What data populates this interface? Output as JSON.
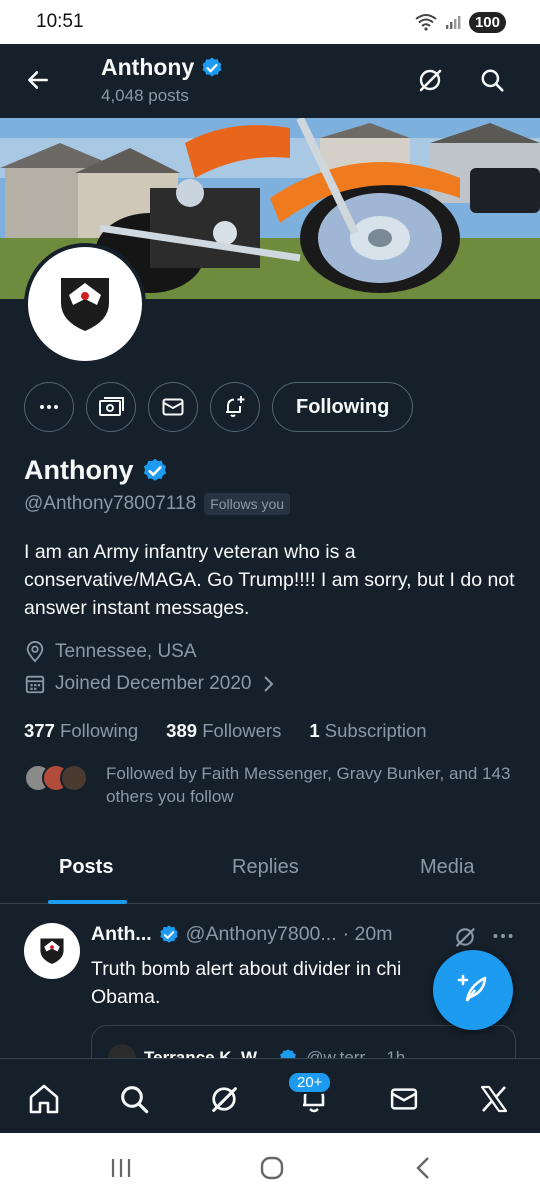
{
  "status_bar": {
    "time": "10:51",
    "battery": "100"
  },
  "header": {
    "name": "Anthony",
    "posts": "4,048 posts"
  },
  "profile": {
    "name": "Anthony",
    "handle": "@Anthony78007118",
    "follows_you": "Follows you",
    "bio": "I am an Army infantry veteran who is a conservative/MAGA. Go Trump!!!! I am sorry, but I do not answer instant messages.",
    "location": "Tennessee, USA",
    "joined": "Joined December 2020",
    "following_count": "377",
    "following_label": "Following",
    "followers_count": "389",
    "followers_label": "Followers",
    "subscription_count": "1",
    "subscription_label": "Subscription",
    "followed_by": "Followed by Faith Messenger, Gravy Bunker, and 143 others you follow"
  },
  "actions": {
    "following_button": "Following"
  },
  "tabs": [
    {
      "label": "Posts"
    },
    {
      "label": "Replies"
    },
    {
      "label": "Media"
    }
  ],
  "tweet": {
    "name": "Anth...",
    "handle": "@Anthony7800...",
    "time": "· 20m",
    "text": "Truth bomb alert about divider in chi Obama.",
    "quote_name": "Terrance K. W...",
    "quote_handle": "@w.terr...",
    "quote_time": "1h"
  },
  "bottom_nav": {
    "notification_badge": "20+"
  },
  "colors": {
    "background": "#15202b",
    "accent": "#1d9bf0",
    "muted_text": "#8b98a5",
    "border": "#536471"
  }
}
